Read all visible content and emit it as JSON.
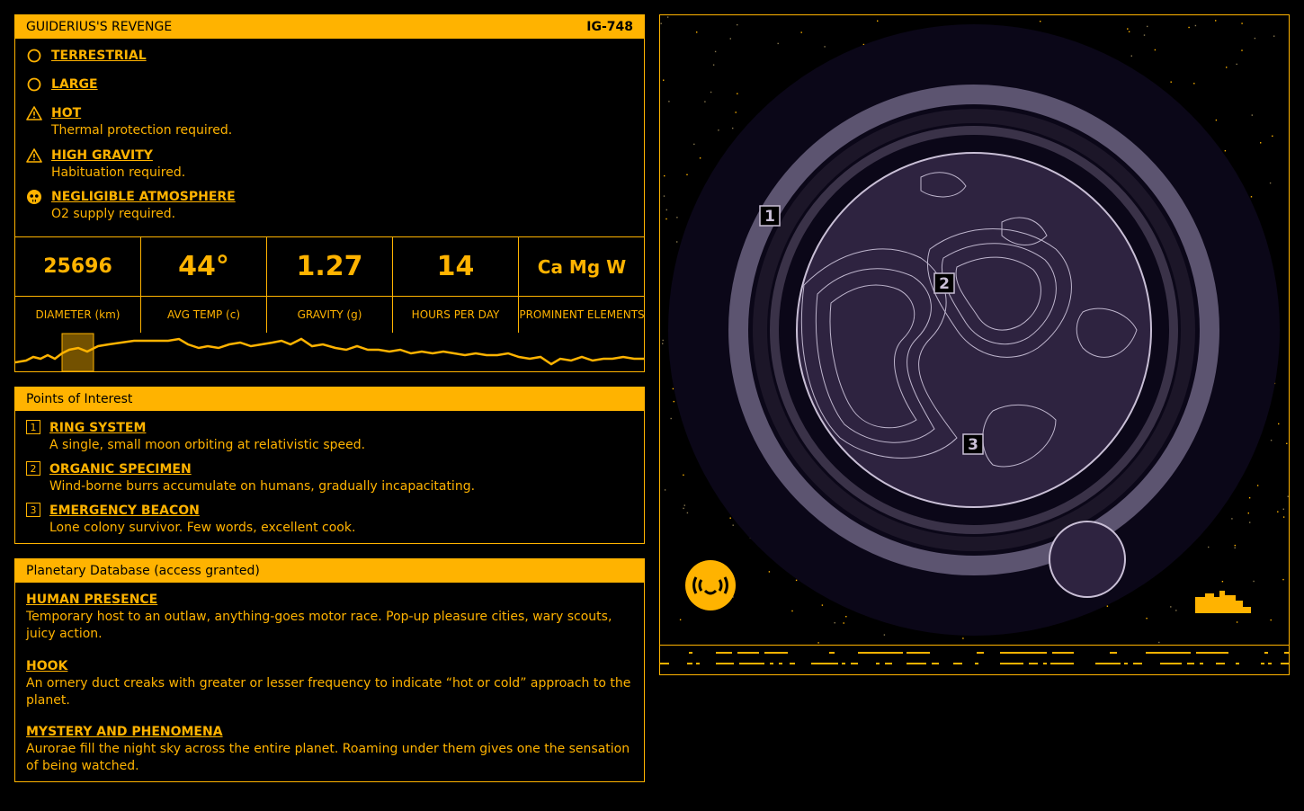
{
  "colors": {
    "accent": "#FFB300",
    "background": "#000000",
    "planet": "#2E2340",
    "ring": "#5C5470"
  },
  "profile": {
    "title": "GUIDERIUS'S REVENGE",
    "code": "IG-748",
    "attributes": [
      {
        "icon": "circle-icon",
        "label": "TERRESTRIAL",
        "desc": ""
      },
      {
        "icon": "circle-icon",
        "label": "LARGE",
        "desc": ""
      },
      {
        "icon": "warning-icon",
        "label": "HOT",
        "desc": "Thermal protection required."
      },
      {
        "icon": "warning-icon",
        "label": "HIGH GRAVITY",
        "desc": "Habituation required."
      },
      {
        "icon": "skull-icon",
        "label": "NEGLIGIBLE ATMOSPHERE",
        "desc": "O2 supply required."
      }
    ],
    "stats": [
      {
        "value": "25696",
        "label": "DIAMETER (km)"
      },
      {
        "value": "44°",
        "label": "AVG TEMP (c)"
      },
      {
        "value": "1.27",
        "label": "GRAVITY (g)"
      },
      {
        "value": "14",
        "label": "HOURS PER DAY"
      },
      {
        "value": "Ca Mg W",
        "label": "PROMINENT ELEMENTS"
      }
    ]
  },
  "poi": {
    "title": "Points of Interest",
    "items": [
      {
        "num": "1",
        "label": "RING SYSTEM",
        "desc": "A single, small moon orbiting at relativistic speed."
      },
      {
        "num": "2",
        "label": "ORGANIC SPECIMEN",
        "desc": "Wind-borne burrs accumulate on humans, gradually incapacitating."
      },
      {
        "num": "3",
        "label": "EMERGENCY BEACON",
        "desc": "Lone colony survivor. Few words, excellent cook."
      }
    ]
  },
  "database": {
    "title": "Planetary Database (access granted)",
    "items": [
      {
        "label": "HUMAN PRESENCE",
        "body": "Temporary host to an outlaw, anything-goes motor race. Pop-up pleasure cities, wary scouts, juicy action."
      },
      {
        "label": "HOOK",
        "body": "An ornery duct creaks with greater or lesser frequency to indicate “hot or cold” approach to the planet."
      },
      {
        "label": "MYSTERY AND PHENOMENA",
        "body": "Aurorae fill the night sky across the entire planet. Roaming under them gives one the sensation of being watched."
      }
    ]
  },
  "map_markers": [
    {
      "num": "1"
    },
    {
      "num": "2"
    },
    {
      "num": "3"
    }
  ]
}
